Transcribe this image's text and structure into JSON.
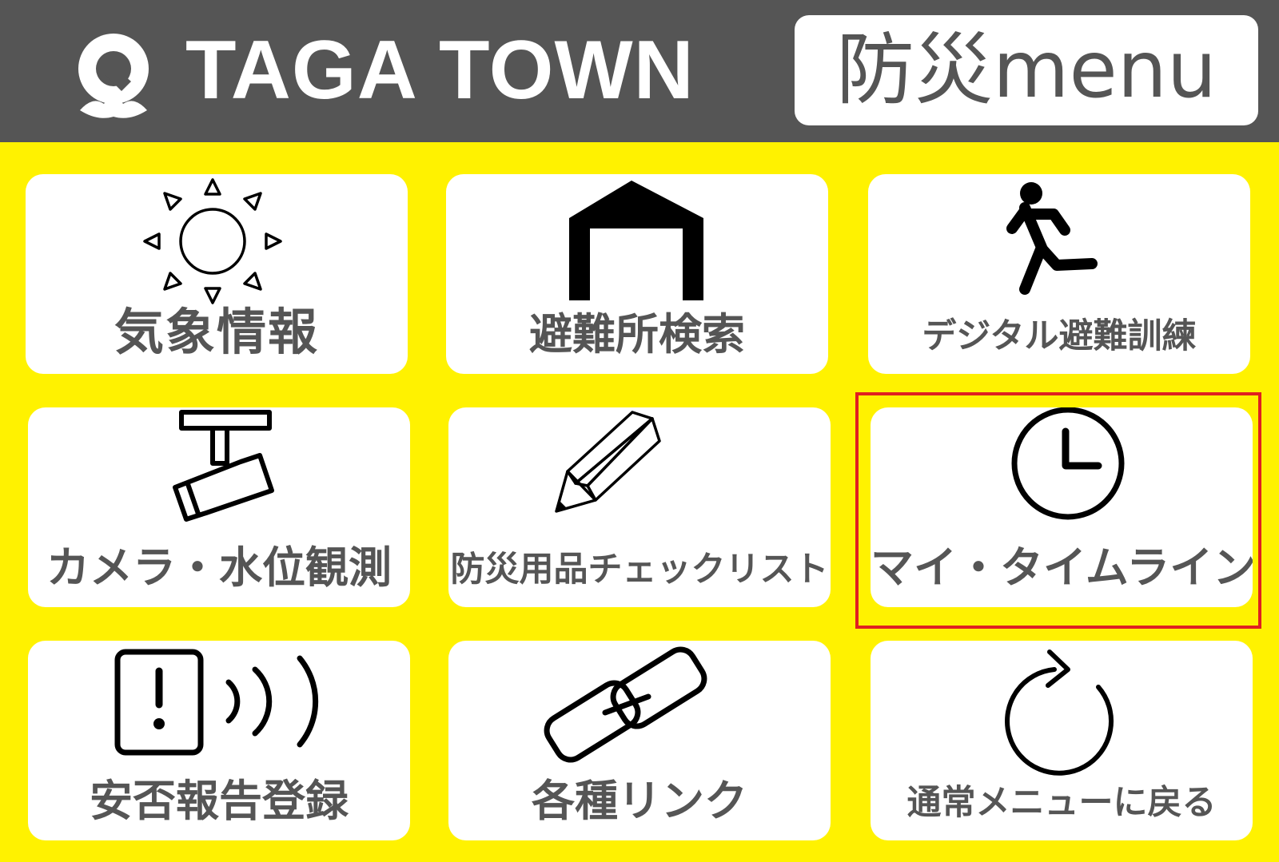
{
  "header": {
    "brand_title": "TAGA TOWN",
    "menu_title": "防災menu",
    "logo_icon": "taga-town-logo-icon"
  },
  "colors": {
    "background": "#fff200",
    "header": "#555555",
    "tile": "#ffffff",
    "label": "#555555",
    "selection": "#e02020"
  },
  "tiles": [
    {
      "label": "気象情報",
      "icon": "sun-icon"
    },
    {
      "label": "避難所検索",
      "icon": "shelter-icon"
    },
    {
      "label": "デジタル避難訓練",
      "icon": "running-person-icon"
    },
    {
      "label": "カメラ・水位観測",
      "icon": "security-camera-icon"
    },
    {
      "label": "防災用品チェックリスト",
      "icon": "pencil-icon"
    },
    {
      "label": "マイ・タイムライン",
      "icon": "clock-icon",
      "selected": true
    },
    {
      "label": "安否報告登録",
      "icon": "phone-signal-icon"
    },
    {
      "label": "各種リンク",
      "icon": "link-icon"
    },
    {
      "label": "通常メニューに戻る",
      "icon": "refresh-icon"
    }
  ]
}
